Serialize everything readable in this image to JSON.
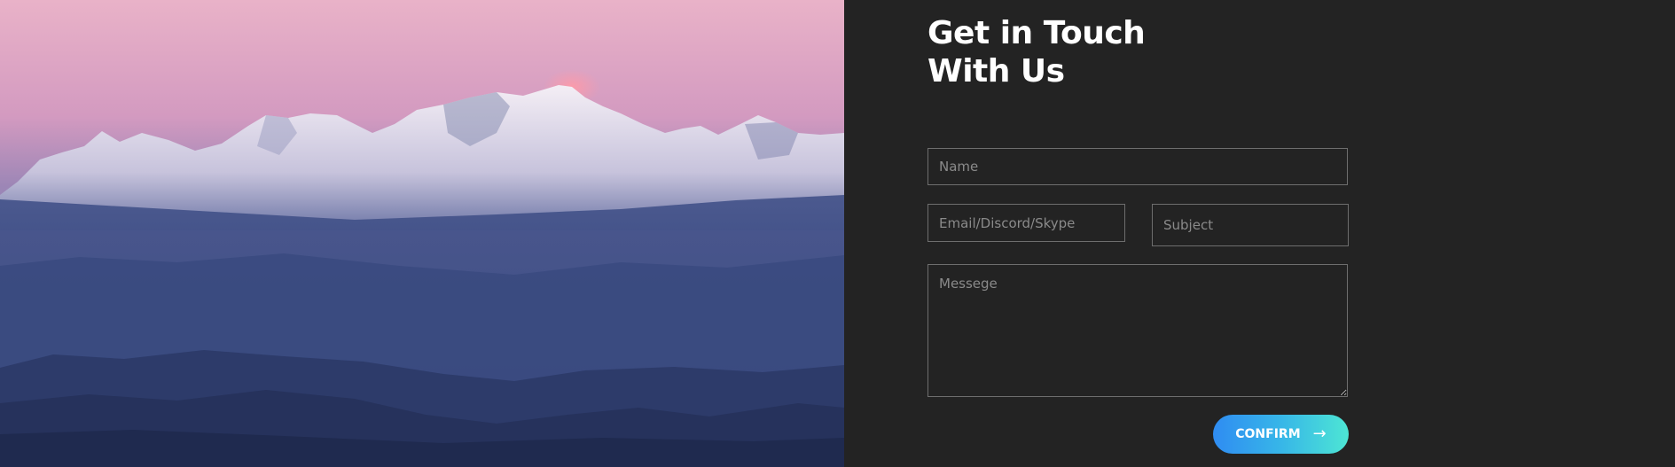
{
  "hero": {
    "image": "mountain-range-at-dusk"
  },
  "contact": {
    "title_line1": "Get in Touch",
    "title_line2": "With Us",
    "name_placeholder": "Name",
    "email_placeholder": "Email/Discord/Skype",
    "subject_placeholder": "Subject",
    "message_placeholder": "Messege",
    "confirm_label": "CONFIRM",
    "confirm_icon": "arrow-right-icon"
  },
  "colors": {
    "panel_bg": "#232323",
    "input_border": "#6e6e6e",
    "button_gradient_start": "#2f8cf2",
    "button_gradient_end": "#4de6d4",
    "sky_top": "#e8b0c6",
    "valley": "#2c3a6a"
  }
}
